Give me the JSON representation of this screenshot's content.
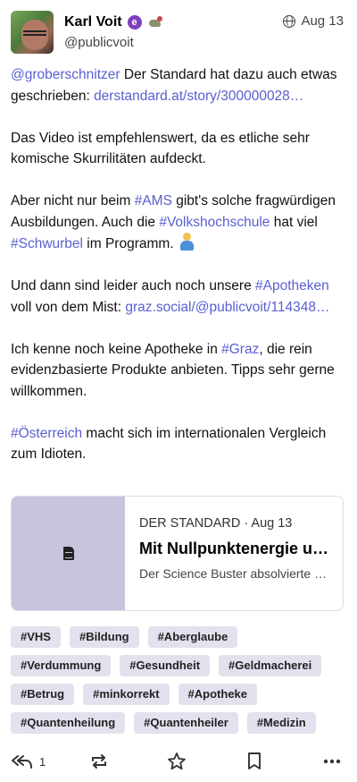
{
  "post": {
    "author_name": "Karl Voit",
    "handle": "@publicvoit",
    "date": "Aug 13",
    "name_emoji_1": "e-badge-icon",
    "name_emoji_2": "mouse-icon",
    "visibility": "public-globe-icon"
  },
  "content": {
    "p1": {
      "mention": "@groberschnitzer",
      "text1": " Der Standard hat dazu auch etwas geschrieben: ",
      "link": "derstandard.at/story/300000028…"
    },
    "p2": {
      "text": "Das Video ist empfehlenswert, da es etliche sehr komische Skurrilitäten aufdeckt."
    },
    "p3": {
      "t1": "Aber nicht nur beim ",
      "h1": "#AMS",
      "t2": " gibt's solche fragwürdigen Ausbildungen. Auch die ",
      "h2": "#Volkshochschule",
      "t3": " hat viel ",
      "h3": "#Schwurbel",
      "t4": " im Programm. ",
      "emoji": "man-facepalming-icon"
    },
    "p4": {
      "t1": "Und dann sind leider auch noch unsere ",
      "h1": "#Apotheken",
      "t2": " voll von dem Mist: ",
      "link": "graz.social/@publicvoit/114348…"
    },
    "p5": {
      "t1": "Ich kenne noch keine Apotheke in ",
      "h1": "#Graz",
      "t2": ", die rein evidenzbasierte Produkte anbieten. Tipps sehr gerne willkommen."
    },
    "p6": {
      "h1": "#Österreich",
      "t1": " macht sich im internationalen Vergleich zum Idioten."
    }
  },
  "card": {
    "source": "DER STANDARD · Aug 13",
    "title": "Mit Nullpunktenergie und Quantenheilung",
    "description": "Der Science Buster absolvierte einen Kurs",
    "thumb_icon": "document-icon"
  },
  "tags": [
    "#VHS",
    "#Bildung",
    "#Aberglaube",
    "#Verdummung",
    "#Gesundheit",
    "#Geldmacherei",
    "#Betrug",
    "#minkorrekt",
    "#Apotheke",
    "#Quantenheilung",
    "#Quantenheiler",
    "#Medizin"
  ],
  "actions": {
    "reply_count": "1"
  }
}
